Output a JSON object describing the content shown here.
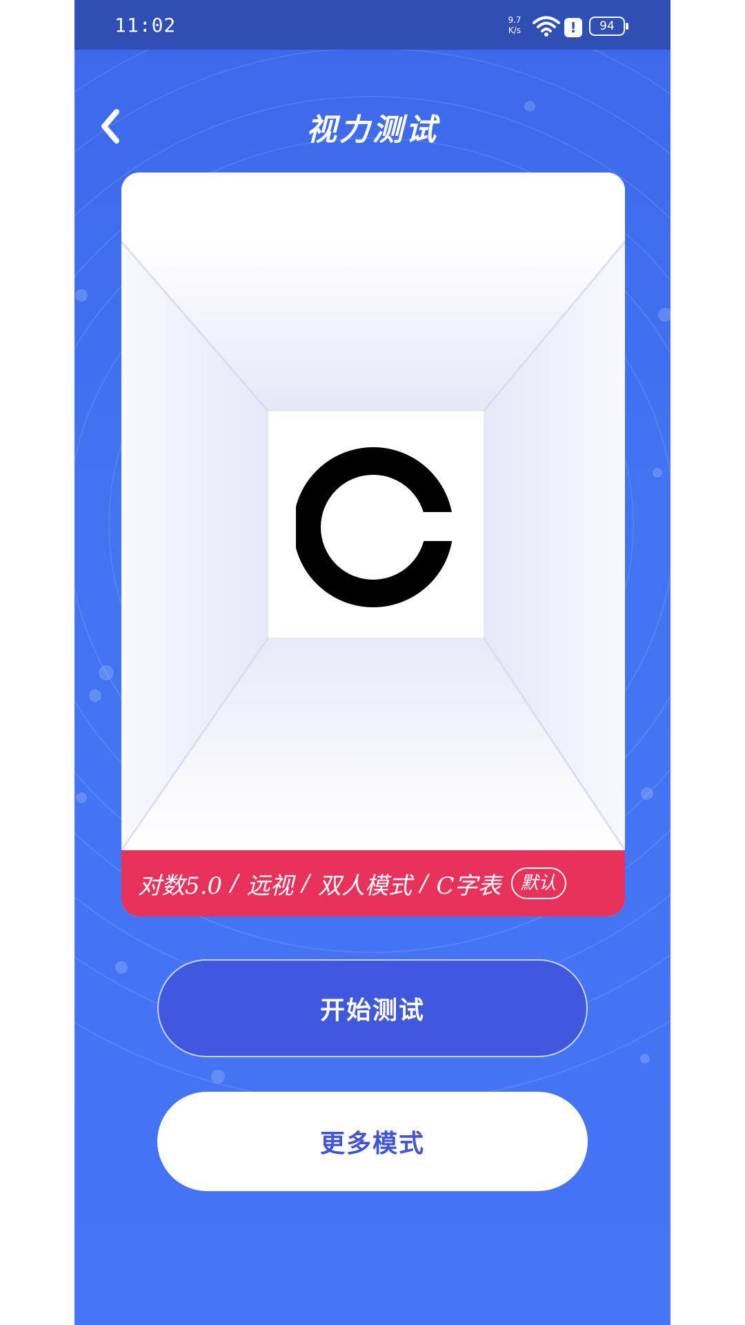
{
  "status_bar": {
    "time": "11:02",
    "net_speed_value": "9.7",
    "net_speed_unit": "K/s",
    "battery": "94"
  },
  "header": {
    "title": "视力测试"
  },
  "test_card": {
    "optotype": "C",
    "settings": {
      "standard": "对数5.0",
      "vision_type": "远视",
      "mode": "双人模式",
      "chart": "C字表",
      "separator": "/",
      "default_badge": "默认"
    }
  },
  "actions": {
    "start_label": "开始测试",
    "more_label": "更多模式"
  },
  "colors": {
    "background": "#4274f1",
    "status_bar": "#2f4fb5",
    "settings_bar": "#e8325b",
    "start_button": "#4058de",
    "more_button_text": "#3f54d6"
  }
}
